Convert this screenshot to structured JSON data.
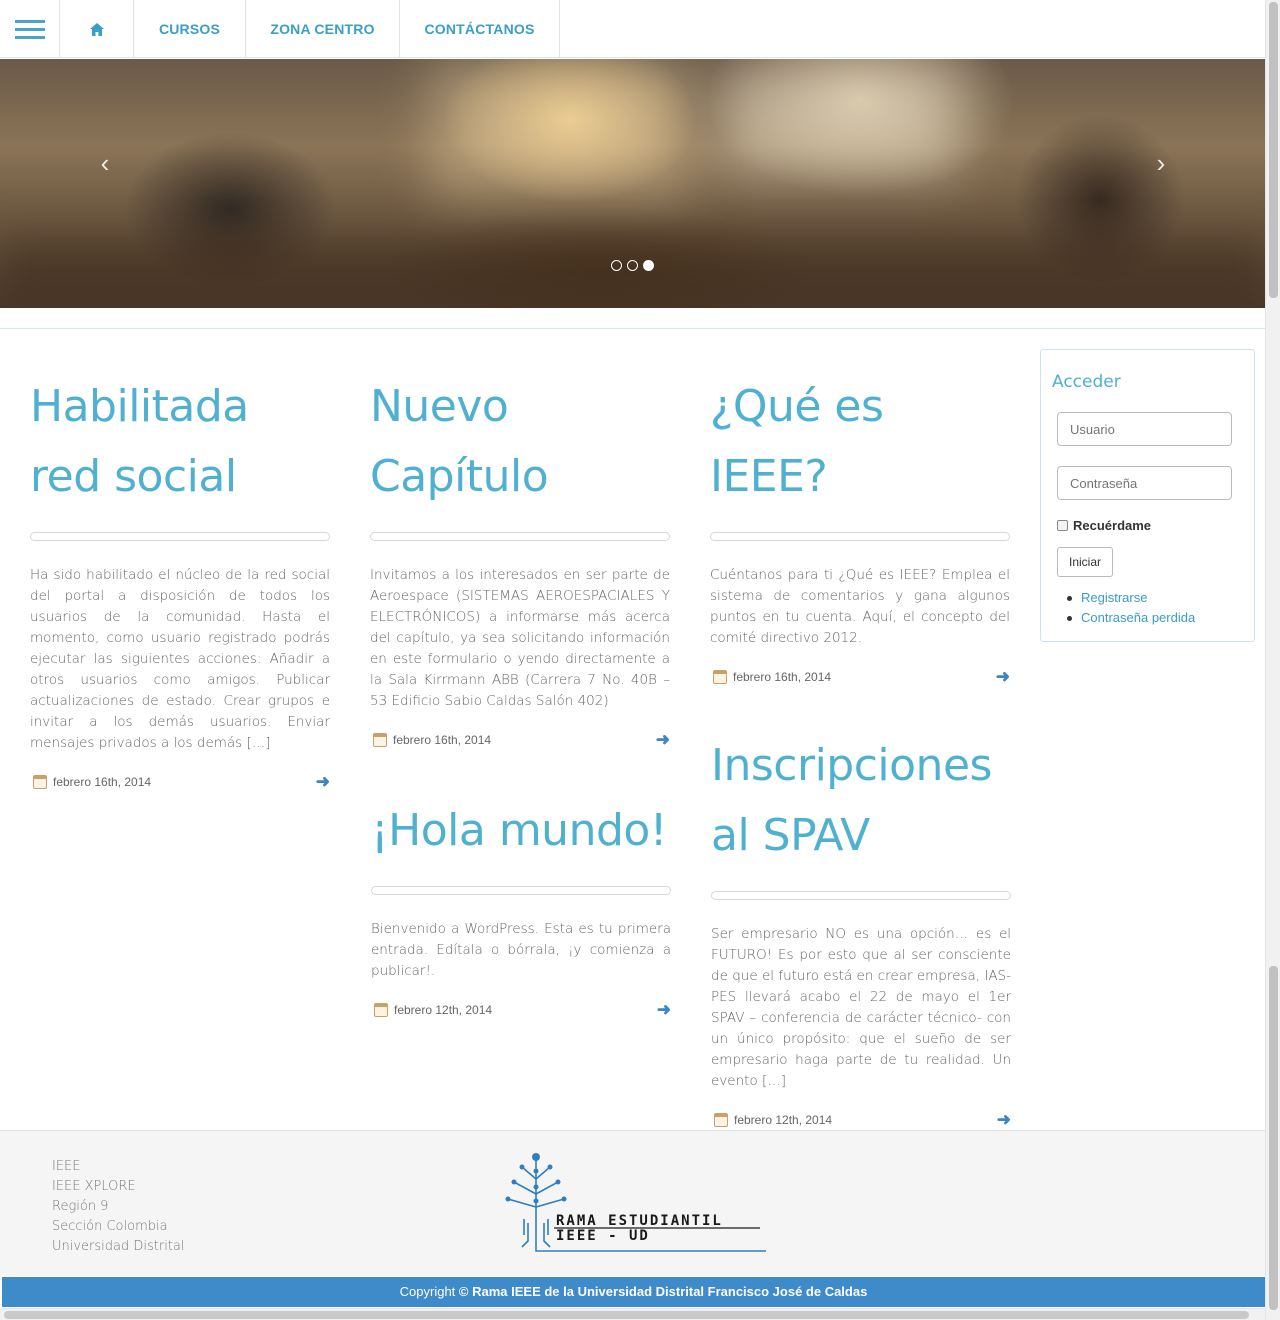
{
  "nav": {
    "items": [
      "CURSOS",
      "ZONA CENTRO",
      "CONTÁCTANOS"
    ]
  },
  "slider": {
    "prev": "‹",
    "next": "›",
    "slides": 3,
    "active_slide": 3
  },
  "posts": [
    {
      "title_line1": "Habilitada",
      "title_line2": "red social",
      "excerpt": "Ha sido habilitado el núcleo de la red social del portal a disposición de todos los usuarios de la comunidad. Hasta el momento, como usuario registrado podrás ejecutar las siguientes acciones: Añadir a otros usuarios como amigos. Publicar actualizaciones de estado. Crear grupos e invitar a los demás usuarios. Enviar mensajes privados a los demás […]",
      "date": "febrero 16th, 2014"
    },
    {
      "title_line1": "Nuevo",
      "title_line2": "Capítulo",
      "excerpt": "Invitamos a los interesados en ser parte de Aeroespace (SISTEMAS AEROESPACIALES Y ELECTRÓNICOS) a informarse más acerca del capítulo, ya sea solicitando información en este formulario o yendo directamente a la Sala Kirrmann ABB (Carrera 7 No. 40B – 53 Edificio Sabio Caldas Salón 402)",
      "date": "febrero 16th, 2014"
    },
    {
      "title_line1": "¿Qué es",
      "title_line2": "IEEE?",
      "excerpt": "Cuéntanos para ti ¿Qué es IEEE? Emplea el sistema de comentarios y gana algunos puntos en tu cuenta. Aquí, el concepto del comité directivo 2012.",
      "date": "febrero 16th, 2014"
    },
    {
      "title_line1": "¡Hola mundo!",
      "title_line2": "",
      "excerpt": "Bienvenido a WordPress. Esta es tu primera entrada. Edítala o bórrala, ¡y comienza a publicar!.",
      "date": "febrero 12th, 2014"
    },
    {
      "title_line1": "Inscripciones",
      "title_line2": "al SPAV",
      "excerpt": "Ser empresario NO es una opción… es el FUTURO! Es por esto que al ser consciente de que el futuro está en crear empresa, IAS-PES llevará acabo el 22 de mayo el 1er SPAV – conferencia de carácter técnico- con un único propósito: que el sueño de ser empresario haga parte de tu realidad. Un evento […]",
      "date": "febrero 12th, 2014"
    }
  ],
  "login": {
    "title": "Acceder",
    "username_placeholder": "Usuario",
    "password_placeholder": "Contraseña",
    "remember": "Recuérdame",
    "submit": "Iniciar",
    "links": [
      "Registrarse",
      "Contraseña perdida"
    ]
  },
  "footer": {
    "links": [
      "IEEE",
      "IEEE XPLORE",
      "Región 9",
      "Sección Colombia",
      "Universidad Distrital"
    ],
    "logo_line1": "RAMA ESTUDIANTIL",
    "logo_line2": "IEEE - UD",
    "copyright_prefix": "Copyright",
    "copyright_owner": "© Rama IEEE de la Universidad Distrital Francisco José de Caldas"
  },
  "colors": {
    "accent": "#4fb0d0",
    "link": "#3a9ec5",
    "footer_bar": "#3f8bc9"
  }
}
